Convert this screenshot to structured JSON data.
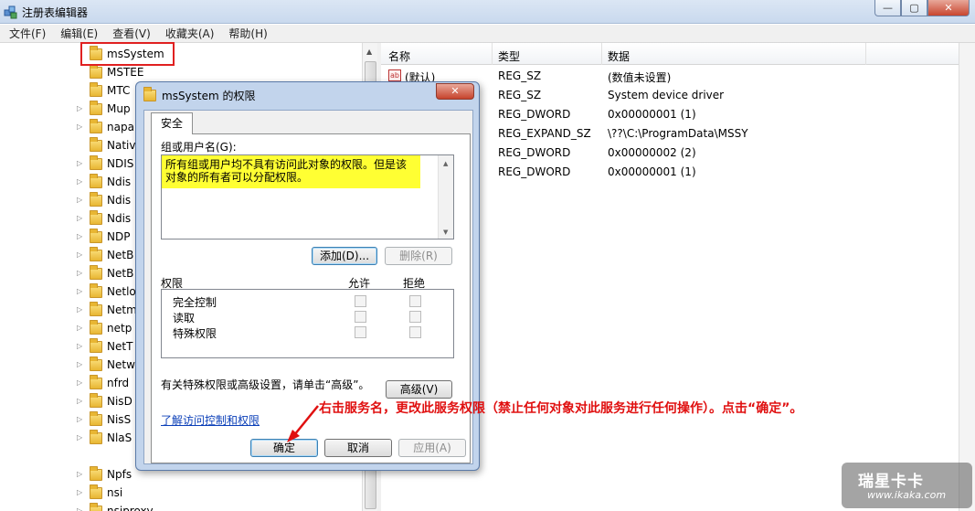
{
  "window": {
    "title": "注册表编辑器",
    "min": "—",
    "max": "▢",
    "close": "✕"
  },
  "menu": [
    "文件(F)",
    "编辑(E)",
    "查看(V)",
    "收藏夹(A)",
    "帮助(H)"
  ],
  "tree": {
    "items": [
      "msSystem",
      "MSTEE",
      "MTC",
      "Mup",
      "napa",
      "Nativ",
      "NDIS",
      "Ndis",
      "Ndis",
      "Ndis",
      "NDP",
      "NetB",
      "NetB",
      "Netlo",
      "Netm",
      "netp",
      "NetT",
      "Netw",
      "nfrd",
      "NisD",
      "NisS",
      "NlaS",
      "Npfs",
      "nsi",
      "nsiproxy"
    ]
  },
  "list": {
    "headers": {
      "name": "名称",
      "type": "类型",
      "data": "数据"
    },
    "rows": [
      {
        "name": "(默认)",
        "type": "REG_SZ",
        "data": "(数值未设置)"
      },
      {
        "name": "",
        "type": "REG_SZ",
        "data": "System device driver"
      },
      {
        "name": "",
        "type": "REG_DWORD",
        "data": "0x00000001 (1)"
      },
      {
        "name": "",
        "type": "REG_EXPAND_SZ",
        "data": "\\??\\C:\\ProgramData\\MSSY"
      },
      {
        "name": "",
        "type": "REG_DWORD",
        "data": "0x00000002 (2)"
      },
      {
        "name": "",
        "type": "REG_DWORD",
        "data": "0x00000001 (1)"
      }
    ]
  },
  "dialog": {
    "title": "msSystem 的权限",
    "tab": "安全",
    "group_label": "组或用户名(G):",
    "users_message": "所有组或用户均不具有访问此对象的权限。但是该对象的所有者可以分配权限。",
    "add_button": "添加(D)...",
    "remove_button": "删除(R)",
    "perm_label": "权限",
    "allow_label": "允许",
    "deny_label": "拒绝",
    "permissions": [
      "完全控制",
      "读取",
      "特殊权限"
    ],
    "advanced_text": "有关特殊权限或高级设置，请单击“高级”。",
    "advanced_button": "高级(V)",
    "link": "了解访问控制和权限",
    "ok_button": "确定",
    "cancel_button": "取消",
    "apply_button": "应用(A)"
  },
  "annotation": "右击服务名，更改此服务权限（禁止任何对象对此服务进行任何操作）。点击“确定”。",
  "watermark": {
    "brand": "瑞星卡卡",
    "url": "www.ikaka.com"
  },
  "colors": {
    "highlight": "#ffff33",
    "annotation": "#e01010",
    "link": "#0b3fb8"
  }
}
